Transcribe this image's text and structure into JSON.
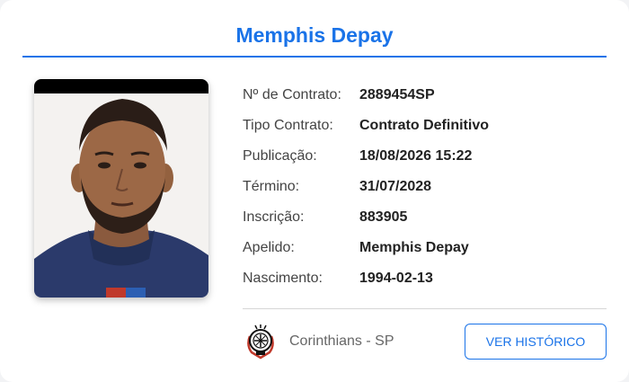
{
  "player": {
    "name": "Memphis Depay"
  },
  "details": [
    {
      "label": "Nº de Contrato:",
      "value": "2889454SP"
    },
    {
      "label": "Tipo Contrato:",
      "value": "Contrato Definitivo"
    },
    {
      "label": "Publicação:",
      "value": "18/08/2026 15:22"
    },
    {
      "label": "Término:",
      "value": "31/07/2028"
    },
    {
      "label": "Inscrição:",
      "value": "883905"
    },
    {
      "label": "Apelido:",
      "value": "Memphis Depay"
    },
    {
      "label": "Nascimento:",
      "value": "1994-02-13"
    }
  ],
  "club": {
    "name": "Corinthians - SP",
    "crest_icon": "corinthians-crest-icon"
  },
  "actions": {
    "history_button_label": "VER HISTÓRICO"
  },
  "colors": {
    "accent": "#1a73e8",
    "card_background": "#ffffff"
  }
}
